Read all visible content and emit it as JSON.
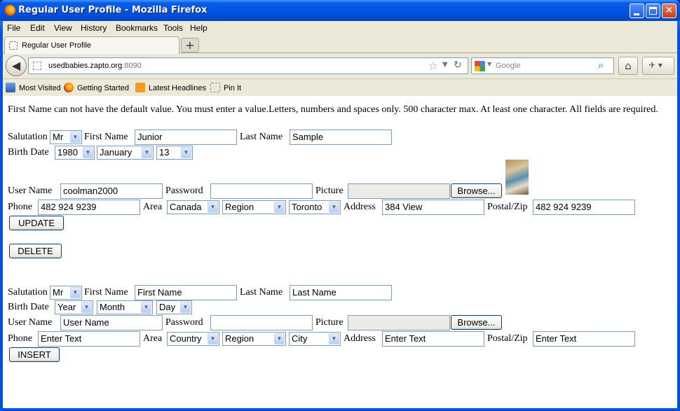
{
  "window": {
    "title": "Regular User Profile - Mozilla Firefox"
  },
  "menubar": [
    "File",
    "Edit",
    "View",
    "History",
    "Bookmarks",
    "Tools",
    "Help"
  ],
  "tab": {
    "label": "Regular User Profile",
    "new_tab": "+"
  },
  "nav": {
    "url_host": "usedbabies.zapto.org",
    "url_port": ":8090",
    "search_placeholder": "Google"
  },
  "bookmarks": [
    "Most Visited",
    "Getting Started",
    "Latest Headlines",
    "Pin It"
  ],
  "page": {
    "message": "First Name can not have the default value. You must enter a value.Letters, numbers and spaces only. 500 character max. At least one character. All fields are required.",
    "labels": {
      "salutation": "Salutation",
      "first_name": "First Name",
      "last_name": "Last Name",
      "birth_date": "Birth Date",
      "user_name": "User Name",
      "password": "Password",
      "picture": "Picture",
      "phone": "Phone",
      "area": "Area",
      "address": "Address",
      "postal": "Postal/Zip"
    },
    "browse_label": "Browse...",
    "edit_form": {
      "salutation": "Mr",
      "first_name": "Junior",
      "last_name": "Sample",
      "birth_year": "1980",
      "birth_month": "January",
      "birth_day": "13",
      "user_name": "coolman2000",
      "password": "",
      "picture": "",
      "phone": "482 924 9239",
      "country": "Canada",
      "region": "Region",
      "city": "Toronto",
      "address": "384 View",
      "postal": "482 924 9239",
      "update_label": "UPDATE",
      "delete_label": "DELETE"
    },
    "insert_form": {
      "salutation": "Mr",
      "first_name": "First Name",
      "last_name": "Last Name",
      "birth_year": "Year",
      "birth_month": "Month",
      "birth_day": "Day",
      "user_name": "User Name",
      "password": "",
      "picture": "",
      "phone": "Enter Text",
      "country": "Country",
      "region": "Region",
      "city": "City",
      "address": "Enter Text",
      "postal": "Enter Text",
      "insert_label": "INSERT"
    }
  }
}
